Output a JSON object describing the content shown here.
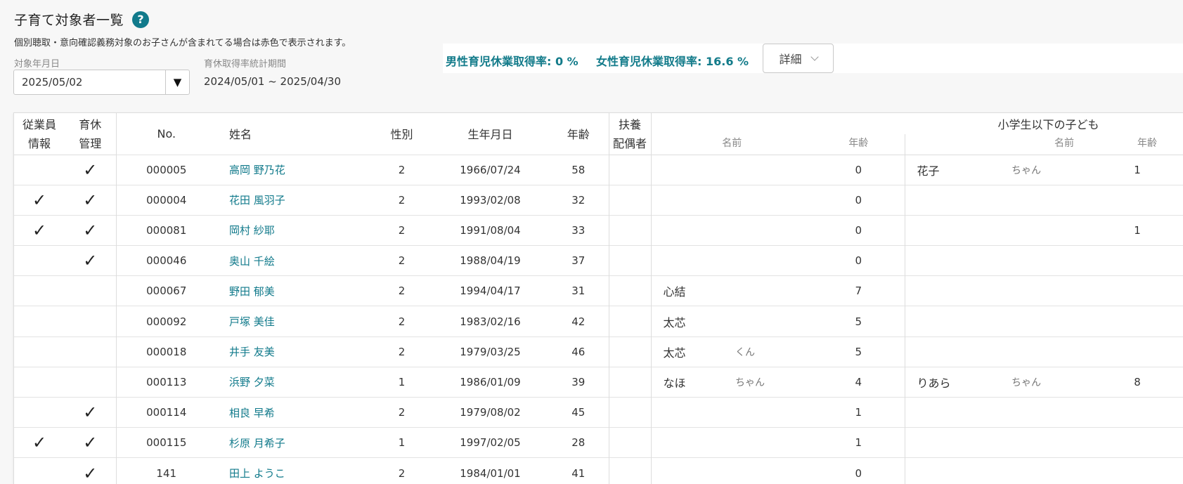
{
  "header": {
    "title": "子育て対象者一覧",
    "help_icon": "?",
    "notice": "個別聴取・意向確認義務対象のお子さんが含まれてる場合は赤色で表示されます。"
  },
  "filters": {
    "date_label": "対象年月日",
    "date_value": "2025/05/02",
    "dropdown_arrow": "▼",
    "period_label": "育休取得率統計期間",
    "period_value": "2024/05/01 ~ 2025/04/30"
  },
  "stats": {
    "male_rate": "男性育児休業取得率: 0 %",
    "female_rate": "女性育児休業取得率: 16.6 %",
    "detail_button": "詳細"
  },
  "colors": {
    "accent": "#117a8b",
    "link": "#117a8b"
  },
  "table": {
    "headers": {
      "employee_info_1": "従業員",
      "employee_info_2": "情報",
      "leave_mgmt_1": "育休",
      "leave_mgmt_2": "管理",
      "no": "No.",
      "name": "姓名",
      "gender": "性別",
      "birthdate": "生年月日",
      "age": "年齢",
      "spouse_1": "扶養",
      "spouse_2": "配偶者",
      "children_group": "小学生以下の子ども",
      "child_name": "名前",
      "child_age": "年齢"
    },
    "check_mark": "✓",
    "rows": [
      {
        "emp": "",
        "leave": "✓",
        "no": "000005",
        "name": "高岡 野乃花",
        "gender": "2",
        "birth": "1966/07/24",
        "age": "58",
        "spouse": "",
        "c1_name": "",
        "c1_suffix": "",
        "c1_age": "0",
        "c2_name": "花子",
        "c2_suffix": "ちゃん",
        "c2_age": "1"
      },
      {
        "emp": "✓",
        "leave": "✓",
        "no": "000004",
        "name": "花田 風羽子",
        "gender": "2",
        "birth": "1993/02/08",
        "age": "32",
        "spouse": "",
        "c1_name": "",
        "c1_suffix": "",
        "c1_age": "0",
        "c2_name": "",
        "c2_suffix": "",
        "c2_age": ""
      },
      {
        "emp": "✓",
        "leave": "✓",
        "no": "000081",
        "name": "岡村 紗耶",
        "gender": "2",
        "birth": "1991/08/04",
        "age": "33",
        "spouse": "",
        "c1_name": "",
        "c1_suffix": "",
        "c1_age": "0",
        "c2_name": "",
        "c2_suffix": "",
        "c2_age": "1"
      },
      {
        "emp": "",
        "leave": "✓",
        "no": "000046",
        "name": "奥山 千絵",
        "gender": "2",
        "birth": "1988/04/19",
        "age": "37",
        "spouse": "",
        "c1_name": "",
        "c1_suffix": "",
        "c1_age": "0",
        "c2_name": "",
        "c2_suffix": "",
        "c2_age": ""
      },
      {
        "emp": "",
        "leave": "",
        "no": "000067",
        "name": "野田 郁美",
        "gender": "2",
        "birth": "1994/04/17",
        "age": "31",
        "spouse": "",
        "c1_name": "心結",
        "c1_suffix": "",
        "c1_age": "7",
        "c2_name": "",
        "c2_suffix": "",
        "c2_age": ""
      },
      {
        "emp": "",
        "leave": "",
        "no": "000092",
        "name": "戸塚 美佳",
        "gender": "2",
        "birth": "1983/02/16",
        "age": "42",
        "spouse": "",
        "c1_name": "太芯",
        "c1_suffix": "",
        "c1_age": "5",
        "c2_name": "",
        "c2_suffix": "",
        "c2_age": ""
      },
      {
        "emp": "",
        "leave": "",
        "no": "000018",
        "name": "井手 友美",
        "gender": "2",
        "birth": "1979/03/25",
        "age": "46",
        "spouse": "",
        "c1_name": "太芯",
        "c1_suffix": "くん",
        "c1_age": "5",
        "c2_name": "",
        "c2_suffix": "",
        "c2_age": ""
      },
      {
        "emp": "",
        "leave": "",
        "no": "000113",
        "name": "浜野 夕菜",
        "gender": "1",
        "birth": "1986/01/09",
        "age": "39",
        "spouse": "",
        "c1_name": "なほ",
        "c1_suffix": "ちゃん",
        "c1_age": "4",
        "c2_name": "りあら",
        "c2_suffix": "ちゃん",
        "c2_age": "8"
      },
      {
        "emp": "",
        "leave": "✓",
        "no": "000114",
        "name": "相良 早希",
        "gender": "2",
        "birth": "1979/08/02",
        "age": "45",
        "spouse": "",
        "c1_name": "",
        "c1_suffix": "",
        "c1_age": "1",
        "c2_name": "",
        "c2_suffix": "",
        "c2_age": ""
      },
      {
        "emp": "✓",
        "leave": "✓",
        "no": "000115",
        "name": "杉原 月希子",
        "gender": "1",
        "birth": "1997/02/05",
        "age": "28",
        "spouse": "",
        "c1_name": "",
        "c1_suffix": "",
        "c1_age": "1",
        "c2_name": "",
        "c2_suffix": "",
        "c2_age": ""
      },
      {
        "emp": "",
        "leave": "✓",
        "no": "141",
        "name": "田上 ようこ",
        "gender": "2",
        "birth": "1984/01/01",
        "age": "41",
        "spouse": "",
        "c1_name": "",
        "c1_suffix": "",
        "c1_age": "0",
        "c2_name": "",
        "c2_suffix": "",
        "c2_age": ""
      }
    ]
  }
}
